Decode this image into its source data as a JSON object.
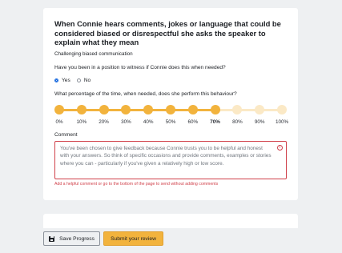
{
  "question": {
    "title": "When Connie hears comments, jokes or language that could be considered biased or disrespectful she asks the speaker to explain what they mean",
    "category": "Challenging biased communication",
    "witness_question": "Have you been in a position to witness if Connie does this when needed?",
    "witness_options": [
      {
        "label": "Yes",
        "selected": true
      },
      {
        "label": "No",
        "selected": false
      }
    ],
    "percentage_question": "What percentage of the time, when needed, does she perform this behaviour?"
  },
  "scale": {
    "labels": [
      "0%",
      "10%",
      "20%",
      "30%",
      "40%",
      "50%",
      "60%",
      "70%",
      "80%",
      "90%",
      "100%"
    ],
    "selected_index": 7,
    "active_color": "#f2b33d",
    "inactive_color": "#fbe9c6"
  },
  "comment": {
    "label": "Comment",
    "placeholder": "You've been chosen to give feedback because Connie trusts you to be helpful and honest with your answers. So think of specific occasions and provide comments, examples or stories where you can - particularly if you've given a relatively high or low score.",
    "error_icon": "!",
    "error": "Add a helpful comment or go to the bottom of the page to send without adding comments"
  },
  "actions": {
    "save_label": "Save Progress",
    "submit_label": "Submit your review"
  },
  "colors": {
    "accent": "#f2b33d",
    "error": "#d0404a",
    "radio": "#1f6fe0"
  }
}
